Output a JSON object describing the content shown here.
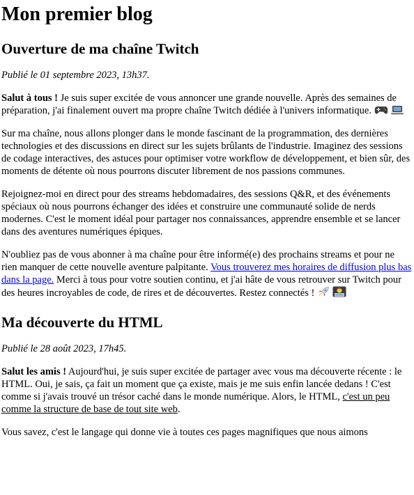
{
  "blog": {
    "title": "Mon premier blog"
  },
  "posts": [
    {
      "title": "Ouverture de ma chaîne Twitch",
      "date": "Publié le 01 septembre 2023, 13h37.",
      "p1_bold": "Salut à tous !",
      "p1_text": " Je suis super excitée de vous annoncer une grande nouvelle. Après des semaines de préparation, j'ai finalement ouvert ma propre chaîne Twitch dédiée à l'univers informatique. ",
      "p2": "Sur ma chaîne, nous allons plonger dans le monde fascinant de la programmation, des dernières technologies et des discussions en direct sur les sujets brûlants de l'industrie. Imaginez des sessions de codage interactives, des astuces pour optimiser votre workflow de développement, et bien sûr, des moments de détente où nous pourrons discuter librement de nos passions communes.",
      "p3": "Rejoignez-moi en direct pour des streams hebdomadaires, des sessions Q&R, et des événements spéciaux où nous pourrons échanger des idées et construire une communauté solide de nerds modernes. C'est le moment idéal pour partager nos connaissances, apprendre ensemble et se lancer dans des aventures numériques épiques.",
      "p4_before": "N'oubliez pas de vous abonner à ma chaîne pour être informé(e) des prochains streams et pour ne rien manquer de cette nouvelle aventure palpitante. ",
      "p4_link": "Vous trouverez mes horaires de diffusion plus bas dans la page.",
      "p4_after": " Merci à tous pour votre soutien continu, et j'ai hâte de vous retrouver sur Twitch pour des heures incroyables de code, de rires et de découvertes. Restez connectés ! "
    },
    {
      "title": "Ma découverte du HTML",
      "date": "Publié le 28 août 2023, 17h45.",
      "p1_bold": "Salut les amis !",
      "p1_text": " Aujourd'hui, je suis super excitée de partager avec vous ma découverte récente : le HTML. Oui, je sais, ça fait un moment que ça existe, mais je me suis enfin lancée dedans ! C'est comme si j'avais trouvé un trésor caché dans le monde numérique. Alors, le HTML, ",
      "p1_underlined": "c'est un peu comme la structure de base de tout site web",
      "p1_end": ".",
      "p2": "Vous savez, c'est le langage qui donne vie à toutes ces pages magnifiques que nous aimons"
    }
  ],
  "icons": [
    "gamepad-icon",
    "laptop-icon",
    "rocket-icon",
    "technologist-icon"
  ]
}
